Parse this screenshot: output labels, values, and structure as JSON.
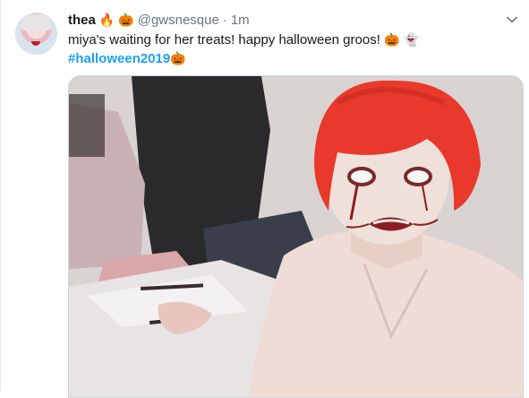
{
  "tweet": {
    "display_name": "thea",
    "name_emojis": [
      "🔥",
      "🎃"
    ],
    "handle": "@gwsnesque",
    "separator": "·",
    "timestamp": "1m",
    "text": "miya's waiting for her treats! happy halloween groos!",
    "text_emojis": [
      "🎃",
      "👻"
    ],
    "hashtag": "#halloween2019",
    "hashtag_emoji": "🎃"
  },
  "icons": {
    "menu": "chevron-down-icon",
    "avatar": "profile-avatar"
  },
  "colors": {
    "link": "#1da1f2",
    "secondary_text": "#657786",
    "primary_text": "#14171a",
    "wig": "#e8392c",
    "shirt": "#f0dcd6"
  }
}
